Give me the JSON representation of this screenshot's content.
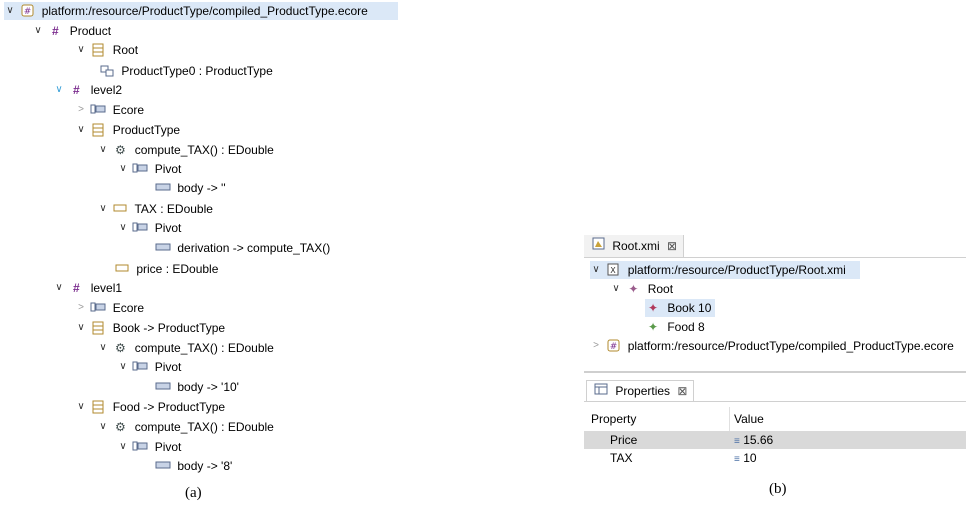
{
  "left_tree": {
    "root_uri": "platform:/resource/ProductType/compiled_ProductType.ecore",
    "product": "Product",
    "root_class": "Root",
    "root_ref": "ProductType0 : ProductType",
    "level2": "level2",
    "ecore1": "Ecore",
    "producttype": "ProductType",
    "compute1": "compute_TAX() : EDouble",
    "pivot1": "Pivot",
    "body1": "body -> ''",
    "tax": "TAX : EDouble",
    "pivot2": "Pivot",
    "derivation": "derivation -> compute_TAX()",
    "price": "price : EDouble",
    "level1": "level1",
    "ecore2": "Ecore",
    "book": "Book -> ProductType",
    "compute2": "compute_TAX() : EDouble",
    "pivot3": "Pivot",
    "body2": "body -> '10'",
    "food": "Food -> ProductType",
    "compute3": "compute_TAX() : EDouble",
    "pivot4": "Pivot",
    "body3": "body -> '8'"
  },
  "caption_a": "(a)",
  "caption_b": "(b)",
  "editor": {
    "tab_label": "Root.xmi",
    "close_glyph": "⊠",
    "xmi_uri": "platform:/resource/ProductType/Root.xmi",
    "root": "Root",
    "book": "Book 10",
    "food": "Food 8",
    "ecore_uri": "platform:/resource/ProductType/compiled_ProductType.ecore"
  },
  "properties": {
    "tab_label": "Properties",
    "close_glyph": "⊠",
    "header_property": "Property",
    "header_value": "Value",
    "rows": [
      {
        "name": "Price",
        "value": "15.66"
      },
      {
        "name": "TAX",
        "value": "10"
      }
    ]
  },
  "colors": {
    "selection": "#dbe8f7",
    "package_icon": "#7b2d8e",
    "class_icon": "#b08a2e",
    "op_icon": "#3d4a4a"
  }
}
